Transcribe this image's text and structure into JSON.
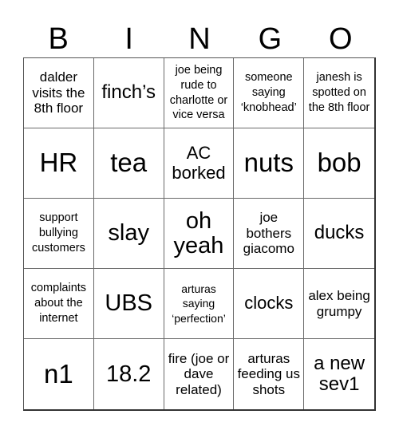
{
  "header": {
    "letters": [
      "B",
      "I",
      "N",
      "G",
      "O"
    ]
  },
  "board": {
    "rows": [
      [
        "dalder visits the 8th floor",
        "finch’s",
        "joe being rude to charlotte or vice versa",
        "someone saying ‘knobhead’",
        "janesh is spotted on the 8th floor"
      ],
      [
        "HR",
        "tea",
        "AC borked",
        "nuts",
        "bob"
      ],
      [
        "support bullying customers",
        "slay",
        "oh yeah",
        "joe bothers giacomo",
        "ducks"
      ],
      [
        "complaints about the internet",
        "UBS",
        "arturas saying ‘perfection’",
        "clocks",
        "alex being grumpy"
      ],
      [
        "n1",
        "18.2",
        "fire (joe or dave related)",
        "arturas feeding us shots",
        "a new sev1"
      ]
    ]
  }
}
